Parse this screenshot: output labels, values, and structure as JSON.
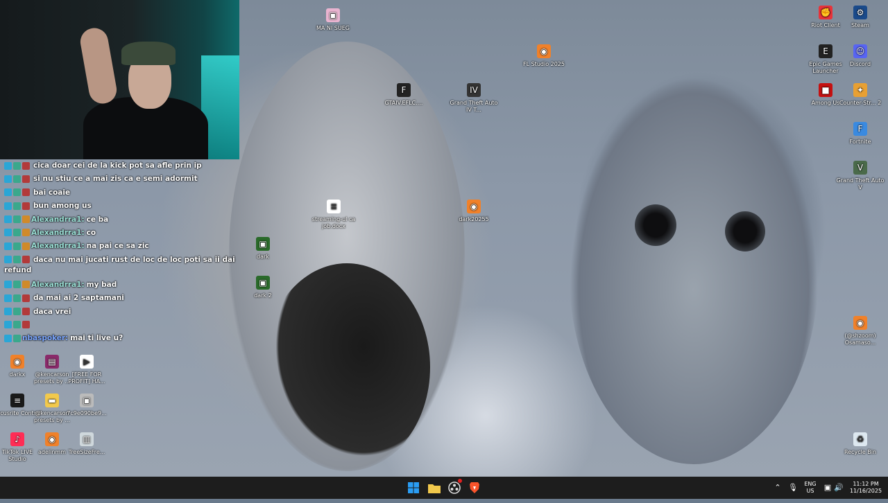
{
  "wallpaper": {
    "label": ""
  },
  "webcam": {
    "label": ""
  },
  "chat": [
    {
      "user": "",
      "text": "cica doar cei de la kick pot sa afle prin ip",
      "color": "#e03a3a"
    },
    {
      "user": "",
      "text": "si nu stiu ce a mai zis ca e semi adormit",
      "color": "#e03a3a"
    },
    {
      "user": "",
      "text": "bai coaie",
      "color": "#e03a3a"
    },
    {
      "user": "",
      "text": "bun among us",
      "color": "#e03a3a"
    },
    {
      "user": "Alexandrra1:",
      "text": "ce ba",
      "color": "#9be0d6"
    },
    {
      "user": "Alexandrra1:",
      "text": "co",
      "color": "#9be0d6"
    },
    {
      "user": "Alexandrra1:",
      "text": "na pai ce sa zic",
      "color": "#9be0d6"
    },
    {
      "user": "",
      "text": "daca nu mai jucati rust de loc de loc poti sa ii dai refund",
      "color": "#e03a3a"
    },
    {
      "user": "Alexandrra1:",
      "text": "my bad",
      "color": "#9be0d6"
    },
    {
      "user": "",
      "text": "da mai ai 2 saptamani",
      "color": "#e03a3a"
    },
    {
      "user": "",
      "text": "daca vrei",
      "color": "#e03a3a"
    },
    {
      "user": "",
      "text": "",
      "color": "#e03a3a"
    },
    {
      "user": "nbaspoker:",
      "text": "mai ti live u?",
      "color": "#7aa6ff"
    }
  ],
  "desktop_icons": [
    {
      "label": "MA NI SUEG",
      "icon": "image-icon",
      "color": "#e9b4d0"
    },
    {
      "label": "FL Studio 2025",
      "icon": "fl-studio-icon",
      "color": "#f0812a"
    },
    {
      "label": "GTAIV.EFLC....",
      "icon": "fusion-fix-icon",
      "color": "#222222"
    },
    {
      "label": "Grand Theft Auto IV T...",
      "icon": "gta4-icon",
      "color": "#333333"
    },
    {
      "label": "streaming-ul ca job.docx",
      "icon": "document-icon",
      "color": "#ffffff"
    },
    {
      "label": "dark20255",
      "icon": "fl-studio-icon",
      "color": "#f0812a"
    },
    {
      "label": "dark",
      "icon": "image-icon",
      "color": "#2a6a2a"
    },
    {
      "label": "dark 2",
      "icon": "image-icon",
      "color": "#2a6a2a"
    },
    {
      "label": "Riot Client",
      "icon": "riot-client-icon",
      "color": "#e8333a"
    },
    {
      "label": "Steam",
      "icon": "steam-icon",
      "color": "#1a4a8a"
    },
    {
      "label": "Epic Games Launcher",
      "icon": "epic-games-icon",
      "color": "#222222"
    },
    {
      "label": "Discord",
      "icon": "discord-icon",
      "color": "#5865f2"
    },
    {
      "label": "Among Us",
      "icon": "among-us-icon",
      "color": "#c51111"
    },
    {
      "label": "Counter-Str... 2",
      "icon": "counter-strike-icon",
      "color": "#e8a033"
    },
    {
      "label": "Fortnite",
      "icon": "fortnite-icon",
      "color": "#3a8ae0"
    },
    {
      "label": "Grand Theft Auto V",
      "icon": "gta5-icon",
      "color": "#4a6a4a"
    },
    {
      "label": "(@shzoom) Osamaso...",
      "icon": "fl-studio-icon",
      "color": "#f0812a"
    },
    {
      "label": "Recycle Bin",
      "icon": "recycle-bin-icon",
      "color": "#dde8f0"
    },
    {
      "label": "darkx",
      "icon": "fl-studio-icon",
      "color": "#f0812a"
    },
    {
      "label": "@kencarson presets by ...",
      "icon": "archive-icon",
      "color": "#8a2a6a"
    },
    {
      "label": "[FREE FOR PROFIT] HA...",
      "icon": "video-icon",
      "color": "#ffffff"
    },
    {
      "label": "Focusrite Control",
      "icon": "focusrite-icon",
      "color": "#1a1a1a"
    },
    {
      "label": "@kencarson presets by ...",
      "icon": "folder-icon",
      "color": "#f2c94c"
    },
    {
      "label": "7c9e090be9...",
      "icon": "image-icon",
      "color": "#bbbbbb"
    },
    {
      "label": "TikTok LIVE Studio",
      "icon": "tiktok-icon",
      "color": "#ff2d55"
    },
    {
      "label": "adelinmm",
      "icon": "fl-studio-icon",
      "color": "#f0812a"
    },
    {
      "label": "TreeSizeFre...",
      "icon": "treesize-icon",
      "color": "#cfd8dc"
    }
  ],
  "taskbar": {
    "apps": [
      {
        "name": "start-button",
        "icon": "windows-icon",
        "color": "#2a9df4"
      },
      {
        "name": "file-explorer",
        "icon": "folder-icon",
        "color": "#f2c94c"
      },
      {
        "name": "obs-studio",
        "icon": "obs-icon",
        "color": "#dddddd"
      },
      {
        "name": "brave-browser",
        "icon": "brave-icon",
        "color": "#fb542b"
      }
    ],
    "lang_line1": "ENG",
    "lang_line2": "US",
    "time": "11:12 PM",
    "date": "11/16/2025"
  }
}
